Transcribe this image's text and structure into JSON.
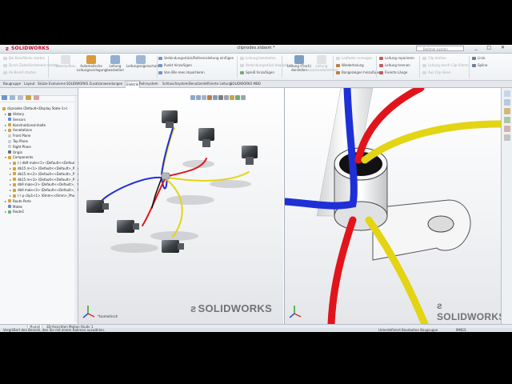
{
  "window": {
    "brand": "SOLIDWORKS",
    "title": "clipnodes.sldasm *",
    "search_placeholder": "Befehle suchen",
    "controls": "_ □ ✕"
  },
  "ribbon": {
    "left_small": [
      {
        "label": "Bei Kreisfläche starten",
        "enabled": false
      },
      {
        "label": "Durch Zubehörelement starten",
        "enabled": false
      },
      {
        "label": "An Bereit starten",
        "enabled": false
      }
    ],
    "big_buttons": [
      {
        "label": "Kabelaufbau",
        "enabled": false
      },
      {
        "label": "Automatische Leitungsverlegung",
        "enabled": true
      },
      {
        "label": "Leitung bearbeiten",
        "enabled": true
      },
      {
        "label": "Leitungseigenschaften",
        "enabled": true
      }
    ],
    "middle_small": [
      {
        "label": "Verbindungsstück/Referenzleitung einfügen",
        "enabled": true
      },
      {
        "label": "Punkt hinzufügen",
        "enabled": true
      },
      {
        "label": "Von-/Bis-rees importieren",
        "enabled": true
      }
    ],
    "middle_small2": [
      {
        "label": "Leitung bearbeiten",
        "enabled": false
      },
      {
        "label": "Verbindungsstück bearbeiten",
        "enabled": false
      },
      {
        "label": "Spleiß hinzufügen",
        "enabled": true
      }
    ],
    "flatten_buttons": [
      {
        "label": "Leitung (Flach) darstellen",
        "enabled": true
      },
      {
        "label": "Leitung auseinanderziehen",
        "enabled": false
      }
    ],
    "right_small": [
      {
        "label": "Leitfaden erzeugen",
        "enabled": false
      },
      {
        "label": "Wiederholung",
        "enabled": true
      },
      {
        "label": "Bangezeigen hinzufügen",
        "enabled": true
      }
    ],
    "right_small2": [
      {
        "label": "Leitung reparieren",
        "enabled": true
      },
      {
        "label": "Leitung trennen",
        "enabled": true
      },
      {
        "label": "Fixierte Länge",
        "enabled": true
      }
    ],
    "right_small3": [
      {
        "label": "Clip drehen",
        "enabled": false
      },
      {
        "label": "Leitung durch Clip führen",
        "enabled": false
      },
      {
        "label": "Aus Clip lösen",
        "enabled": false
      }
    ],
    "far_right": [
      {
        "label": "Linie",
        "enabled": true
      },
      {
        "label": "Spline",
        "enabled": true
      }
    ]
  },
  "command_tabs": [
    {
      "label": "Baugruppe",
      "active": false
    },
    {
      "label": "Layout",
      "active": false
    },
    {
      "label": "Skizze",
      "active": false
    },
    {
      "label": "Evaluieren",
      "active": false
    },
    {
      "label": "SOLIDWORKS Zusatzanwendungen",
      "active": false
    },
    {
      "label": "Elektrik",
      "active": true
    },
    {
      "label": "Rohrsystem",
      "active": false
    },
    {
      "label": "Schlauchsystem",
      "active": false
    },
    {
      "label": "Benutzerdefinierte Leitung",
      "active": false
    },
    {
      "label": "SOLIDWORKS MBD",
      "active": false
    }
  ],
  "tree": {
    "root": "clipnodes (Default<Display State-1>)",
    "items": [
      {
        "label": "History",
        "level": 1,
        "expander": "▸",
        "color": "#7a7f86"
      },
      {
        "label": "Sensors",
        "level": 1,
        "expander": "",
        "color": "#5a8fd6"
      },
      {
        "label": "Konstruktionsinhalte",
        "level": 1,
        "expander": "▸",
        "color": "#d8a238"
      },
      {
        "label": "Annotations",
        "level": 1,
        "expander": "▸",
        "color": "#d8a238"
      },
      {
        "label": "Front Plane",
        "level": 1,
        "expander": "",
        "color": "#c9cdd3"
      },
      {
        "label": "Top Plane",
        "level": 1,
        "expander": "",
        "color": "#c9cdd3"
      },
      {
        "label": "Right Plane",
        "level": 1,
        "expander": "",
        "color": "#c9cdd3"
      },
      {
        "label": "Origin",
        "level": 1,
        "expander": "",
        "color": "#6b6f75"
      },
      {
        "label": "Components",
        "level": 1,
        "expander": "▾",
        "color": "#d8a238"
      },
      {
        "label": "(-) db9 male<1> (Default<<Default>_Pho",
        "level": 2,
        "expander": "▸",
        "color": "#d8a238"
      },
      {
        "label": "db15 m<1> (Default<<Default>_Pho",
        "level": 2,
        "expander": "▸",
        "color": "#d8a238"
      },
      {
        "label": "db15 m<2> (Default<<Default>_Pho",
        "level": 2,
        "expander": "▸",
        "color": "#d8a238"
      },
      {
        "label": "db15 m<3> (Default<<Default>_Pho",
        "level": 2,
        "expander": "▸",
        "color": "#d8a238"
      },
      {
        "label": "db9 male<2> (Default<<Default>_Ph",
        "level": 2,
        "expander": "▸",
        "color": "#d8a238"
      },
      {
        "label": "db9 male<3> (Default<<Default>_Ph",
        "level": 2,
        "expander": "▸",
        "color": "#d8a238"
      },
      {
        "label": "(-) p clip1<1> (6mm<<6mm>_Photo",
        "level": 2,
        "expander": "▸",
        "color": "#d8a238"
      },
      {
        "label": "Route Parts",
        "level": 1,
        "expander": "▸",
        "color": "#d8a238"
      },
      {
        "label": "Mates",
        "level": 1,
        "expander": "",
        "color": "#6b8bc4"
      },
      {
        "label": "Route1",
        "level": 1,
        "expander": "▸",
        "color": "#6bb36b"
      }
    ]
  },
  "viewports": {
    "left": {
      "watermark": "SOLIDWORKS",
      "label": "*Isometrisch"
    },
    "right": {
      "watermark": "SOLIDWORKS",
      "label": ""
    }
  },
  "bottom_tabs": [
    {
      "label": "Modell",
      "active": true
    },
    {
      "label": "3D-Ansichten",
      "active": false
    },
    {
      "label": "Motion-Study 1",
      "active": false
    }
  ],
  "status": {
    "message": "Vergrößert den Bereich, den Sie mit einem Rahmen auswählen.",
    "definition": "Unterdefiniert",
    "editing": "Bearbeiten Baugruppe",
    "units": "MMGS"
  },
  "wire_colors": {
    "red": "#e2141b",
    "blue": "#1f2fd6",
    "yellow": "#e3d414",
    "black": "#0d0d0d"
  }
}
